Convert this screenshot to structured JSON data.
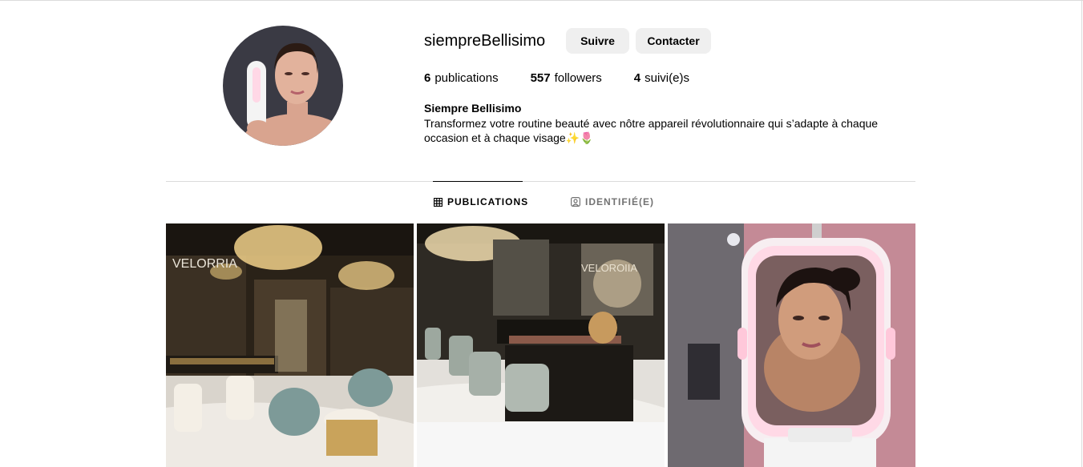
{
  "profile": {
    "username": "siempreBellisimo",
    "follow_label": "Suivre",
    "contact_label": "Contacter",
    "stats": {
      "publications_count": "6",
      "publications_label": "publications",
      "followers_count": "557",
      "followers_label": "followers",
      "following_count": "4",
      "following_label": "suivi(e)s"
    },
    "display_name": "Siempre Bellisimo",
    "bio": "Transformez votre routine beauté avec nôtre appareil révolutionnaire qui s’adapte à chaque occasion et à chaque visage✨🌷"
  },
  "tabs": {
    "publications": "PUBLICATIONS",
    "tagged": "IDENTIFIÉ(E)"
  },
  "posts": {
    "post1_sign": "VELORRIA",
    "post2_sign": "VELOROIIA"
  },
  "colors": {
    "border": "#dbdbdb",
    "button_bg": "#efefef",
    "inactive_tab": "#737373"
  },
  "icons": {
    "publications_tab": "grid-icon",
    "tagged_tab": "tagged-person-icon"
  }
}
